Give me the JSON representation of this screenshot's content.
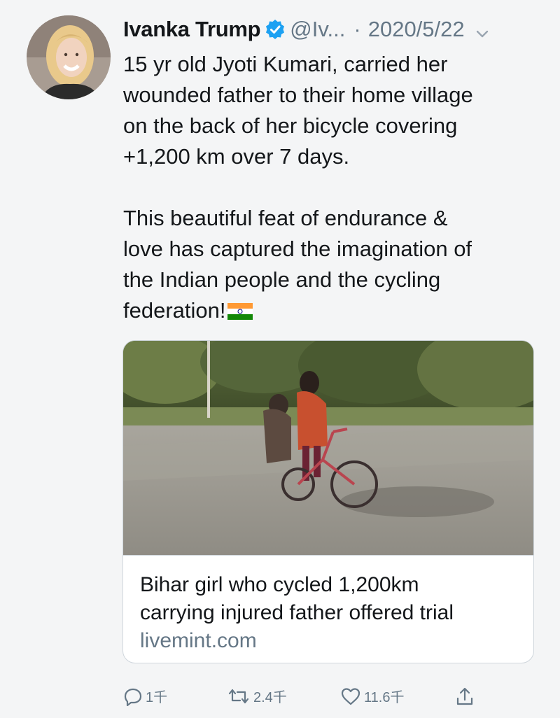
{
  "tweet": {
    "author_name": "Ivanka Trump",
    "handle": "@Iv...",
    "separator": "·",
    "date": "2020/5/22",
    "paragraph_1": "15 yr old Jyoti Kumari, carried her\nwounded father to their home village\non the back of her bicycle covering\n+1,200 km over 7 days.",
    "paragraph_2": "This beautiful feat of endurance &\nlove has captured the imagination of\nthe Indian people and the cycling\nfederation!",
    "flag_icon": "india-flag-emoji"
  },
  "card": {
    "title": "Bihar girl who cycled 1,200km\ncarrying injured father offered trial",
    "domain": "livemint.com"
  },
  "actions": {
    "reply_count": "1千",
    "retweet_count": "2.4千",
    "like_count": "11.6千"
  },
  "colors": {
    "verified_blue": "#1da1f2",
    "secondary_text": "#657786",
    "background": "#f4f5f6"
  }
}
